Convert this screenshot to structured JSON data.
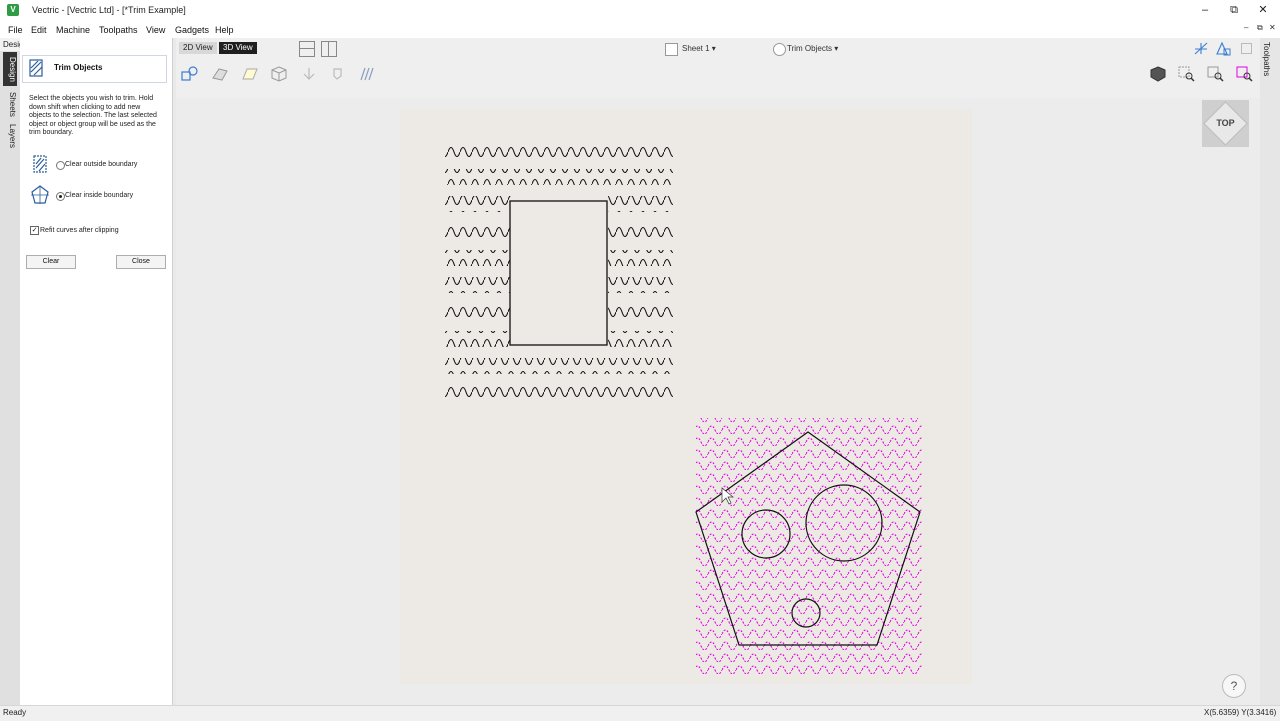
{
  "window": {
    "title": "Vectric - [Vectric Ltd] - [*Trim Example]",
    "app_icon": "vectric-app-icon",
    "controls": [
      "minimize",
      "restore",
      "close"
    ]
  },
  "menu": {
    "items": [
      "File",
      "Edit",
      "Machine",
      "Toolpaths",
      "View",
      "Gadgets",
      "Help"
    ]
  },
  "panel": {
    "label": "Design",
    "side_tabs": [
      "Design",
      "Sheets",
      "Layers"
    ],
    "title": "Trim Objects",
    "description": "Select the objects you wish to trim. Hold down shift when clicking to add new objects to the selection. The last selected object or object group will be used as the trim boundary.",
    "options": [
      {
        "label": "Clear outside boundary",
        "selected": false
      },
      {
        "label": "Clear inside boundary",
        "selected": true
      }
    ],
    "refit": {
      "label": "Refit curves after clipping",
      "checked": true
    },
    "buttons": {
      "clear": "Clear",
      "close": "Close"
    }
  },
  "view_toolbar": {
    "tabs": [
      "2D View",
      "3D View"
    ],
    "active_tab": "3D View",
    "sheet_dropdown": "Sheet 1",
    "mode_dropdown": "Trim Objects"
  },
  "right_panel": {
    "tab": "Toolpaths"
  },
  "view_cube": {
    "label": "TOP"
  },
  "help": "?",
  "status": {
    "left": "Ready",
    "coords": "X(5.6359) Y(3.3416)"
  },
  "colors": {
    "accent": "#2e9c45",
    "selection": "#e000e0",
    "active_tab_bg": "#1f1f1f",
    "material": "#ede9e4"
  }
}
